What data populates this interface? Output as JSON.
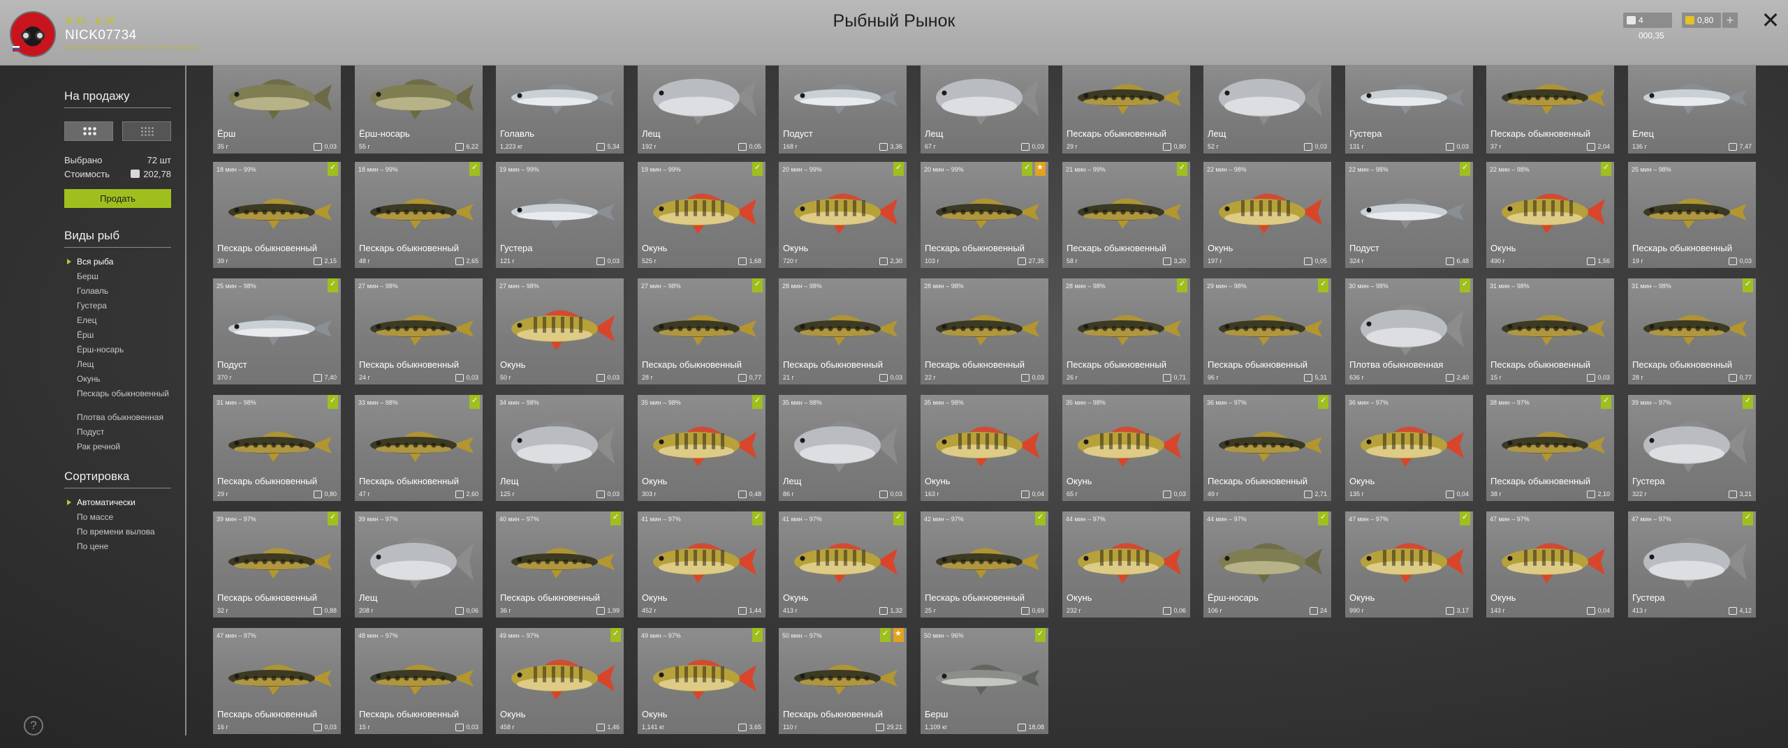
{
  "header": {
    "title": "Рыбный Рынок",
    "username": "NICK07734",
    "rank": "Мастер морской ловли в отве 3 ранга",
    "stat1": "40",
    "stat2": "28",
    "currency_silver": "4 000,35",
    "currency_gold": "0,80"
  },
  "sidebar": {
    "sale_heading": "На продажу",
    "selected_label": "Выбрано",
    "selected_value": "72 шт",
    "cost_label": "Стоимость",
    "cost_value": "202,78",
    "sell_button": "Продать",
    "species_heading": "Виды рыб",
    "species": [
      "Вся рыба",
      "Берш",
      "Голавль",
      "Густера",
      "Елец",
      "Ёрш",
      "Ёрш-носарь",
      "Лещ",
      "Окунь",
      "Пескарь обыкновенный",
      "Плотва обыкновенная",
      "Подуст",
      "Рак речной"
    ],
    "sort_heading": "Сортировка",
    "sort_options": [
      "Автоматически",
      "По массе",
      "По времени вылова",
      "По цене"
    ]
  },
  "colors": {
    "accent": "#9fbf1e",
    "gold": "#e3a21f",
    "header_bg": "#b0b0b0"
  },
  "fish_icons": {
    "perch": "perch-fish-icon",
    "gudgeon": "gudgeon-fish-icon",
    "silver": "silver-fish-icon",
    "bream": "bream-fish-icon",
    "ruffe": "ruffe-fish-icon",
    "zander": "zander-fish-icon"
  },
  "cards": [
    {
      "t": "",
      "n": "Ёрш",
      "w": "35 г",
      "p": "0,03",
      "k": "ruffe",
      "b": []
    },
    {
      "t": "",
      "n": "Ёрш-носарь",
      "w": "55 г",
      "p": "6,22",
      "k": "ruffe",
      "b": []
    },
    {
      "t": "",
      "n": "Голавль",
      "w": "1,223 кг",
      "p": "5,34",
      "k": "silver",
      "b": []
    },
    {
      "t": "",
      "n": "Лещ",
      "w": "192 г",
      "p": "0,05",
      "k": "bream",
      "b": []
    },
    {
      "t": "",
      "n": "Подуст",
      "w": "168 г",
      "p": "3,36",
      "k": "silver",
      "b": []
    },
    {
      "t": "",
      "n": "Лещ",
      "w": "67 г",
      "p": "0,03",
      "k": "bream",
      "b": []
    },
    {
      "t": "",
      "n": "Пескарь обыкновенный",
      "w": "29 г",
      "p": "0,80",
      "k": "gudgeon",
      "b": []
    },
    {
      "t": "",
      "n": "Лещ",
      "w": "52 г",
      "p": "0,03",
      "k": "bream",
      "b": []
    },
    {
      "t": "",
      "n": "Густера",
      "w": "131 г",
      "p": "0,03",
      "k": "silver",
      "b": []
    },
    {
      "t": "",
      "n": "Пескарь обыкновенный",
      "w": "37 г",
      "p": "2,04",
      "k": "gudgeon",
      "b": []
    },
    {
      "t": "",
      "n": "Елец",
      "w": "136 г",
      "p": "7,47",
      "k": "silver",
      "b": []
    },
    {
      "t": "18 мин – 99%",
      "n": "Пескарь обыкновенный",
      "w": "39 г",
      "p": "2,15",
      "k": "gudgeon",
      "b": [
        "g"
      ]
    },
    {
      "t": "18 мин – 99%",
      "n": "Пескарь обыкновенный",
      "w": "48 г",
      "p": "2,65",
      "k": "gudgeon",
      "b": [
        "g"
      ]
    },
    {
      "t": "19 мин – 99%",
      "n": "Густера",
      "w": "121 г",
      "p": "0,03",
      "k": "silver",
      "b": []
    },
    {
      "t": "19 мин – 99%",
      "n": "Окунь",
      "w": "525 г",
      "p": "1,68",
      "k": "perch",
      "b": [
        "g"
      ]
    },
    {
      "t": "20 мин – 99%",
      "n": "Окунь",
      "w": "720 г",
      "p": "2,30",
      "k": "perch",
      "b": [
        "g"
      ]
    },
    {
      "t": "20 мин – 99%",
      "n": "Пескарь обыкновенный",
      "w": "103 г",
      "p": "27,35",
      "k": "gudgeon",
      "b": [
        "g",
        "s"
      ]
    },
    {
      "t": "21 мин – 99%",
      "n": "Пескарь обыкновенный",
      "w": "58 г",
      "p": "3,20",
      "k": "gudgeon",
      "b": [
        "g"
      ]
    },
    {
      "t": "22 мин – 98%",
      "n": "Окунь",
      "w": "197 г",
      "p": "0,05",
      "k": "perch",
      "b": []
    },
    {
      "t": "22 мин – 98%",
      "n": "Подуст",
      "w": "324 г",
      "p": "6,48",
      "k": "silver",
      "b": [
        "g"
      ]
    },
    {
      "t": "22 мин – 98%",
      "n": "Окунь",
      "w": "490 г",
      "p": "1,56",
      "k": "perch",
      "b": [
        "g"
      ]
    },
    {
      "t": "25 мин – 98%",
      "n": "Пескарь обыкновенный",
      "w": "19 г",
      "p": "0,03",
      "k": "gudgeon",
      "b": []
    },
    {
      "t": "25 мин – 98%",
      "n": "Подуст",
      "w": "370 г",
      "p": "7,40",
      "k": "silver",
      "b": [
        "g"
      ]
    },
    {
      "t": "27 мин – 98%",
      "n": "Пескарь обыкновенный",
      "w": "24 г",
      "p": "0,03",
      "k": "gudgeon",
      "b": []
    },
    {
      "t": "27 мин – 98%",
      "n": "Окунь",
      "w": "50 г",
      "p": "0,03",
      "k": "perch",
      "b": []
    },
    {
      "t": "27 мин – 98%",
      "n": "Пескарь обыкновенный",
      "w": "28 г",
      "p": "0,77",
      "k": "gudgeon",
      "b": [
        "g"
      ]
    },
    {
      "t": "28 мин – 98%",
      "n": "Пескарь обыкновенный",
      "w": "21 г",
      "p": "0,03",
      "k": "gudgeon",
      "b": []
    },
    {
      "t": "28 мин – 98%",
      "n": "Пескарь обыкновенный",
      "w": "22 г",
      "p": "0,03",
      "k": "gudgeon",
      "b": []
    },
    {
      "t": "28 мин – 98%",
      "n": "Пескарь обыкновенный",
      "w": "26 г",
      "p": "0,71",
      "k": "gudgeon",
      "b": [
        "g"
      ]
    },
    {
      "t": "29 мин – 98%",
      "n": "Пескарь обыкновенный",
      "w": "96 г",
      "p": "5,31",
      "k": "gudgeon",
      "b": [
        "g"
      ]
    },
    {
      "t": "30 мин – 98%",
      "n": "Плотва обыкновенная",
      "w": "636 г",
      "p": "2,40",
      "k": "bream",
      "b": [
        "g"
      ]
    },
    {
      "t": "31 мин – 98%",
      "n": "Пескарь обыкновенный",
      "w": "15 г",
      "p": "0,03",
      "k": "gudgeon",
      "b": []
    },
    {
      "t": "31 мин – 98%",
      "n": "Пескарь обыкновенный",
      "w": "28 г",
      "p": "0,77",
      "k": "gudgeon",
      "b": [
        "g"
      ]
    },
    {
      "t": "31 мин – 98%",
      "n": "Пескарь обыкновенный",
      "w": "29 г",
      "p": "0,80",
      "k": "gudgeon",
      "b": [
        "g"
      ]
    },
    {
      "t": "33 мин – 98%",
      "n": "Пескарь обыкновенный",
      "w": "47 г",
      "p": "2,60",
      "k": "gudgeon",
      "b": [
        "g"
      ]
    },
    {
      "t": "34 мин – 98%",
      "n": "Лещ",
      "w": "125 г",
      "p": "0,03",
      "k": "bream",
      "b": []
    },
    {
      "t": "35 мин – 98%",
      "n": "Окунь",
      "w": "303 г",
      "p": "0,48",
      "k": "perch",
      "b": [
        "g"
      ]
    },
    {
      "t": "35 мин – 98%",
      "n": "Лещ",
      "w": "86 г",
      "p": "0,03",
      "k": "bream",
      "b": []
    },
    {
      "t": "35 мин – 98%",
      "n": "Окунь",
      "w": "163 г",
      "p": "0,04",
      "k": "perch",
      "b": []
    },
    {
      "t": "35 мин – 98%",
      "n": "Окунь",
      "w": "65 г",
      "p": "0,03",
      "k": "perch",
      "b": []
    },
    {
      "t": "36 мин – 97%",
      "n": "Пескарь обыкновенный",
      "w": "49 г",
      "p": "2,71",
      "k": "gudgeon",
      "b": [
        "g"
      ]
    },
    {
      "t": "36 мин – 97%",
      "n": "Окунь",
      "w": "135 г",
      "p": "0,04",
      "k": "perch",
      "b": []
    },
    {
      "t": "38 мин – 97%",
      "n": "Пескарь обыкновенный",
      "w": "38 г",
      "p": "2,10",
      "k": "gudgeon",
      "b": [
        "g"
      ]
    },
    {
      "t": "39 мин – 97%",
      "n": "Густера",
      "w": "322 г",
      "p": "3,21",
      "k": "bream",
      "b": [
        "g"
      ]
    },
    {
      "t": "39 мин – 97%",
      "n": "Пескарь обыкновенный",
      "w": "32 г",
      "p": "0,88",
      "k": "gudgeon",
      "b": [
        "g"
      ]
    },
    {
      "t": "39 мин – 97%",
      "n": "Лещ",
      "w": "208 г",
      "p": "0,06",
      "k": "bream",
      "b": []
    },
    {
      "t": "40 мин – 97%",
      "n": "Пескарь обыкновенный",
      "w": "36 г",
      "p": "1,99",
      "k": "gudgeon",
      "b": [
        "g"
      ]
    },
    {
      "t": "41 мин – 97%",
      "n": "Окунь",
      "w": "452 г",
      "p": "1,44",
      "k": "perch",
      "b": [
        "g"
      ]
    },
    {
      "t": "41 мин – 97%",
      "n": "Окунь",
      "w": "413 г",
      "p": "1,32",
      "k": "perch",
      "b": [
        "g"
      ]
    },
    {
      "t": "42 мин – 97%",
      "n": "Пескарь обыкновенный",
      "w": "25 г",
      "p": "0,69",
      "k": "gudgeon",
      "b": [
        "g"
      ]
    },
    {
      "t": "44 мин – 97%",
      "n": "Окунь",
      "w": "232 г",
      "p": "0,06",
      "k": "perch",
      "b": []
    },
    {
      "t": "44 мин – 97%",
      "n": "Ёрш-носарь",
      "w": "106 г",
      "p": "24",
      "k": "ruffe",
      "b": [
        "g"
      ]
    },
    {
      "t": "47 мин – 97%",
      "n": "Окунь",
      "w": "990 г",
      "p": "3,17",
      "k": "perch",
      "b": [
        "g"
      ]
    },
    {
      "t": "47 мин – 97%",
      "n": "Окунь",
      "w": "143 г",
      "p": "0,04",
      "k": "perch",
      "b": []
    },
    {
      "t": "47 мин – 97%",
      "n": "Густера",
      "w": "413 г",
      "p": "4,12",
      "k": "bream",
      "b": [
        "g"
      ]
    },
    {
      "t": "47 мин – 97%",
      "n": "Пескарь обыкновенный",
      "w": "16 г",
      "p": "0,03",
      "k": "gudgeon",
      "b": []
    },
    {
      "t": "48 мин – 97%",
      "n": "Пескарь обыкновенный",
      "w": "15 г",
      "p": "0,03",
      "k": "gudgeon",
      "b": []
    },
    {
      "t": "49 мин – 97%",
      "n": "Окунь",
      "w": "458 г",
      "p": "1,46",
      "k": "perch",
      "b": [
        "g"
      ]
    },
    {
      "t": "49 мин – 97%",
      "n": "Окунь",
      "w": "1,141 кг",
      "p": "3,65",
      "k": "perch",
      "b": [
        "g"
      ]
    },
    {
      "t": "50 мин – 97%",
      "n": "Пескарь обыкновенный",
      "w": "110 г",
      "p": "29,21",
      "k": "gudgeon",
      "b": [
        "g",
        "s"
      ]
    },
    {
      "t": "50 мин – 96%",
      "n": "Берш",
      "w": "1,109 кг",
      "p": "18,08",
      "k": "zander",
      "b": [
        "g"
      ]
    }
  ]
}
